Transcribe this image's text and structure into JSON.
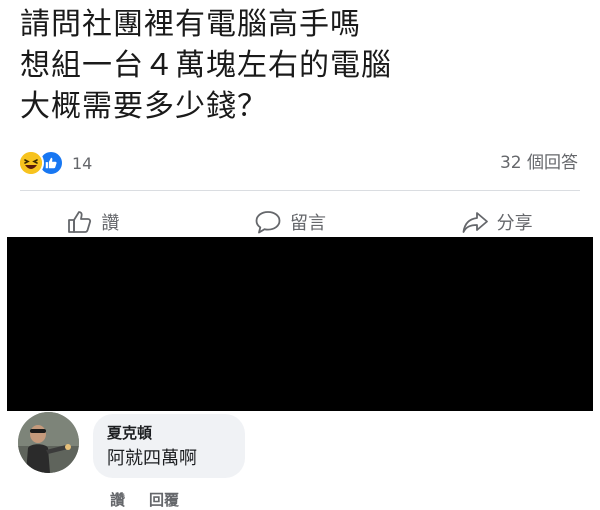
{
  "post": {
    "lines": [
      "請問社團裡有電腦高手嗎",
      "想組一台４萬塊左右的電腦",
      "大概需要多少錢？"
    ]
  },
  "reactions": {
    "icons": [
      "haha-icon",
      "like-icon"
    ],
    "count": "14"
  },
  "comment_count": "32 個回答",
  "actions": {
    "like": "讚",
    "comment": "留言",
    "share": "分享"
  },
  "comment": {
    "author": "夏克頓",
    "text": "阿就四萬啊",
    "like": "讚",
    "reply": "回覆"
  },
  "colors": {
    "like_blue": "#1877f2",
    "haha_yellow": "#f7c31f",
    "muted_text": "#65676b",
    "bubble_bg": "#f0f2f5",
    "redacted": "#000000"
  }
}
